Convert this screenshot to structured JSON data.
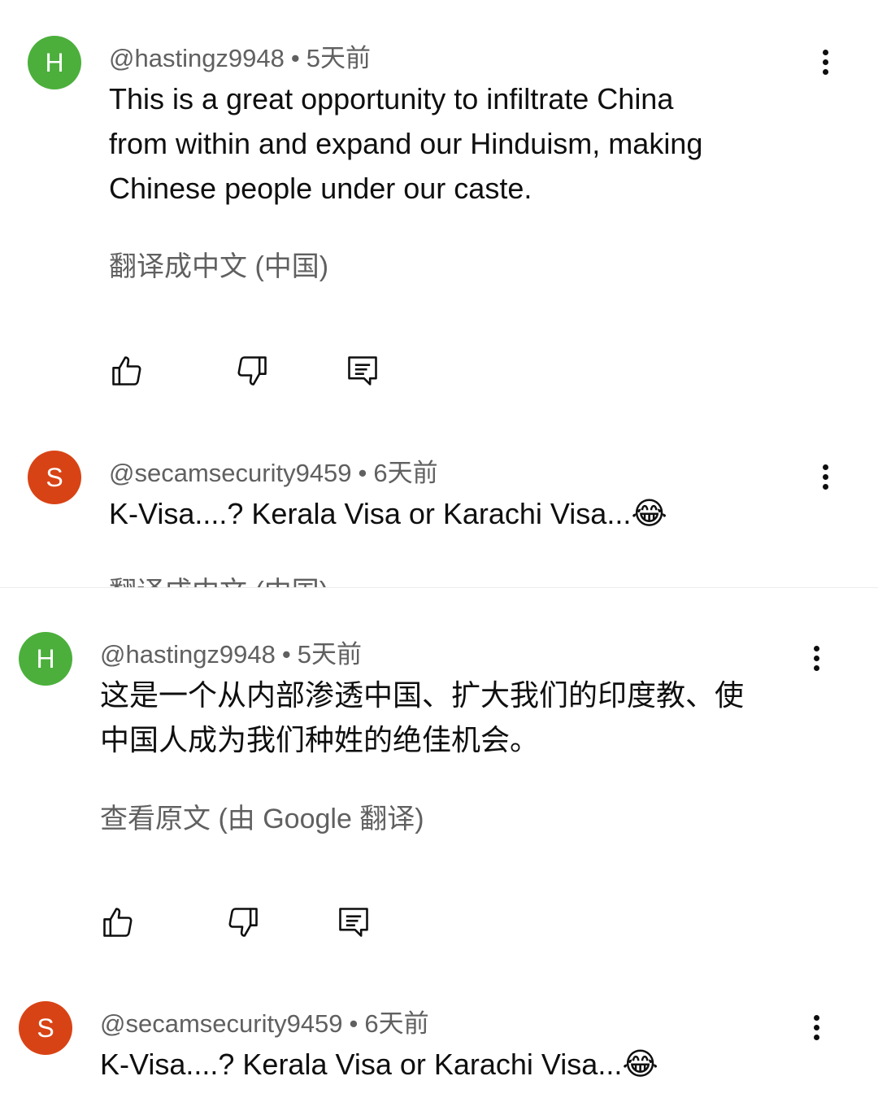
{
  "comments": [
    {
      "avatar_letter": "H",
      "avatar_color": "#4caf3c",
      "handle": "@hastingz9948",
      "separator": "•",
      "age": "5天前",
      "lines": [
        "This is a great opportunity to infiltrate China",
        "from within and expand our Hinduism, making",
        "Chinese people under our caste."
      ],
      "translate_link": "翻译成中文 (中国)"
    },
    {
      "avatar_letter": "S",
      "avatar_color": "#d84315",
      "handle": "@secamsecurity9459",
      "separator": "•",
      "age": "6天前",
      "text": "K-Visa....?  Kerala Visa or Karachi Visa...",
      "emoji": "😂",
      "translate_link": "翻译成中文 (中国)"
    },
    {
      "avatar_letter": "H",
      "avatar_color": "#4caf3c",
      "handle": "@hastingz9948",
      "separator": "•",
      "age": "5天前",
      "lines": [
        "这是一个从内部渗透中国、扩大我们的印度教、使",
        "中国人成为我们种姓的绝佳机会。"
      ],
      "translate_link": "查看原文 (由 Google 翻译)"
    },
    {
      "avatar_letter": "S",
      "avatar_color": "#d84315",
      "handle": "@secamsecurity9459",
      "separator": "•",
      "age": "6天前",
      "text": "K-Visa....?  Kerala Visa or Karachi Visa...",
      "emoji": "😂"
    }
  ],
  "icons": {
    "like": "thumbs-up-icon",
    "dislike": "thumbs-down-icon",
    "reply": "reply-comment-icon",
    "menu": "more-vertical-icon"
  }
}
